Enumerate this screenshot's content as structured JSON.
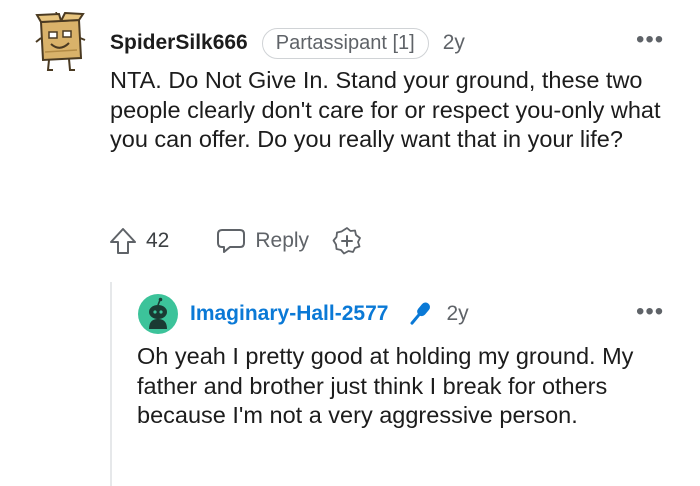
{
  "comment": {
    "username": "SpiderSilk666",
    "flair": "Partassipant [1]",
    "age": "2y",
    "more": "•••",
    "body": "NTA. Do Not Give In. Stand your ground, these two people clearly don't care for or respect you-only what you can offer. Do you really want that in your life?",
    "upvotes": "42",
    "reply_label": "Reply",
    "avatar_icon": "cardboard-box-snoo-avatar-icon"
  },
  "reply": {
    "username": "Imaginary-Hall-2577",
    "badge_icon": "microphone-icon",
    "age": "2y",
    "more": "•••",
    "body": "Oh yeah I pretty good at holding my ground. My father and brother just think I break for others because I'm not a very aggressive person.",
    "avatar_icon": "teal-snoo-avatar-icon"
  },
  "colors": {
    "text": "#1c1c1c",
    "muted": "#5f6368",
    "reply_username": "#0a79d6",
    "reply_avatar_bg": "#3cc39a",
    "thread_line": "#e6e8ea"
  }
}
